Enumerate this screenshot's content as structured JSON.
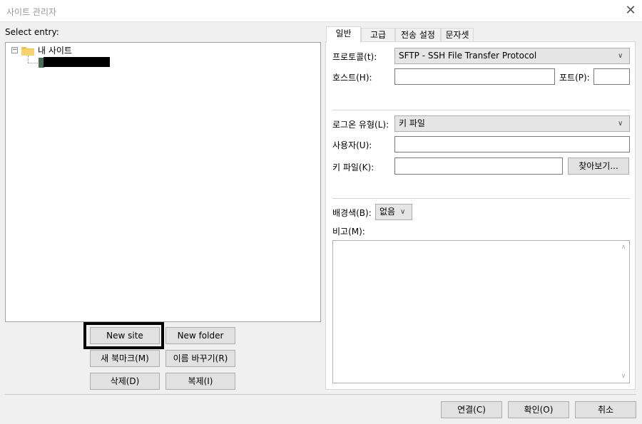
{
  "window": {
    "title": "사이트 관리자"
  },
  "left": {
    "select_entry_label": "Select entry:",
    "tree": {
      "root_label": "내 사이트"
    }
  },
  "buttons": {
    "new_site": "New site",
    "new_folder": "New folder",
    "new_bookmark": "새 북마크(M)",
    "rename": "이름 바꾸기(R)",
    "delete": "삭제(D)",
    "copy": "복제(I)"
  },
  "tabs": [
    "일반",
    "고급",
    "전송 설정",
    "문자셋"
  ],
  "general": {
    "protocol_label": "프로토콜(t):",
    "protocol_value": "SFTP - SSH File Transfer Protocol",
    "host_label": "호스트(H):",
    "host_value": "",
    "port_label": "포트(P):",
    "port_value": "",
    "logon_type_label": "로그온 유형(L):",
    "logon_type_value": "키 파일",
    "user_label": "사용자(U):",
    "user_value": "",
    "keyfile_label": "키 파일(K):",
    "keyfile_value": "",
    "browse_button": "찾아보기...",
    "bgcolor_label": "배경색(B):",
    "bgcolor_value": "없음",
    "comments_label": "비고(M):",
    "comments_value": ""
  },
  "footer": {
    "connect": "연결(C)",
    "ok": "확인(O)",
    "cancel": "취소"
  },
  "icons": {
    "close": "close-icon",
    "folder": "folder-icon",
    "site": "site-icon",
    "dropdown": "chevron-down-icon"
  }
}
